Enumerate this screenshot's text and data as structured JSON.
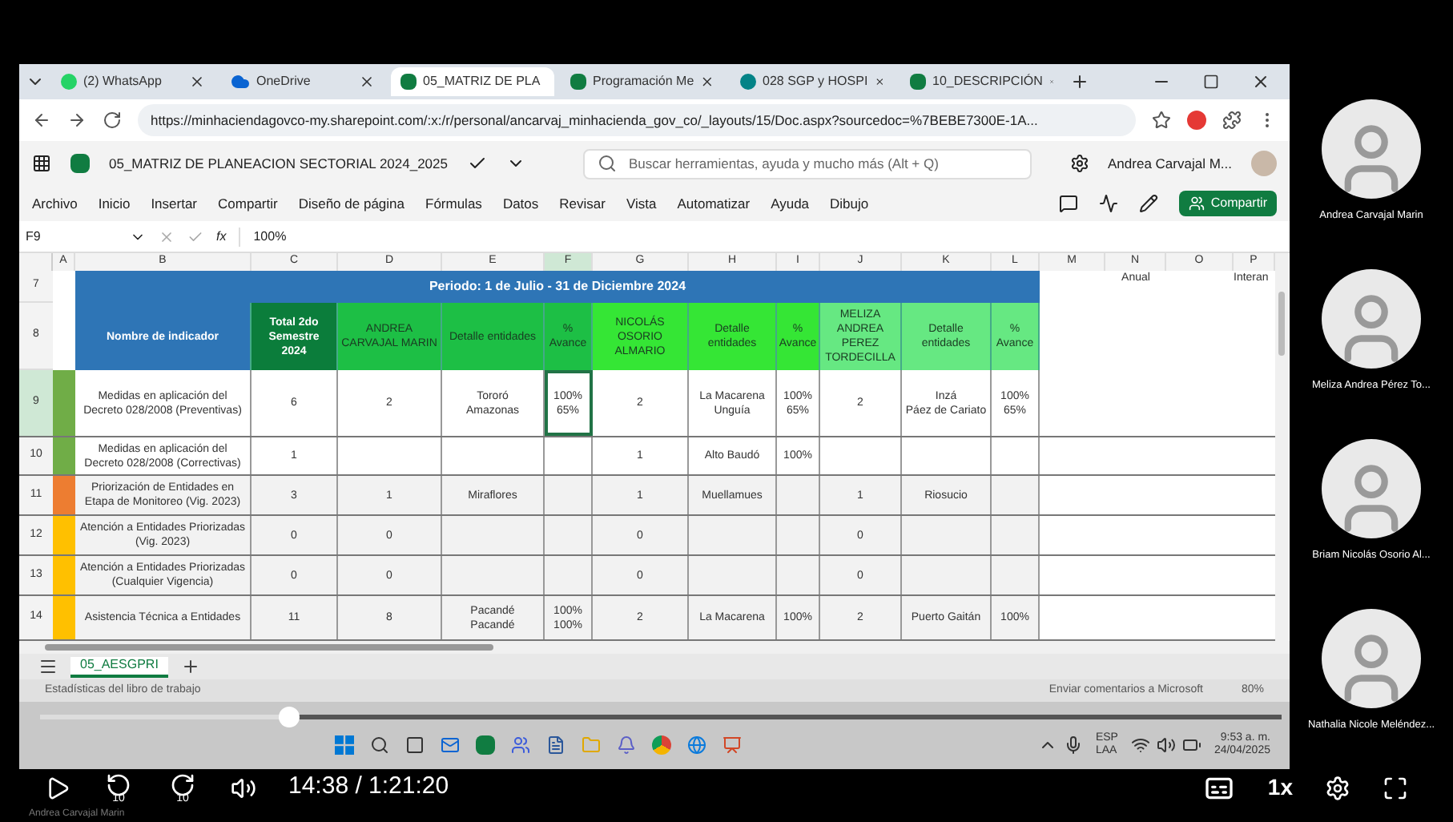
{
  "browser": {
    "tabs": [
      {
        "label": "(2) WhatsApp",
        "kind": "whatsapp",
        "selected": false
      },
      {
        "label": "OneDrive",
        "kind": "onedrive",
        "selected": false
      },
      {
        "label": "05_MATRIZ DE PLA",
        "kind": "excel",
        "selected": true
      },
      {
        "label": "Programación Me",
        "kind": "excel",
        "selected": false
      },
      {
        "label": "028 SGP y HOSPI",
        "kind": "sharepoint",
        "selected": false
      },
      {
        "label": "10_DESCRIPCIÓN",
        "kind": "excel",
        "selected": false
      }
    ],
    "url": "https://minhaciendagovco-my.sharepoint.com/:x:/r/personal/ancarvaj_minhacienda_gov_co/_layouts/15/Doc.aspx?sourcedoc=%7BEBE7300E-1A..."
  },
  "excel": {
    "file_name": "05_MATRIZ DE PLANEACION SECTORIAL 2024_2025",
    "search": {
      "placeholder": "Buscar herramientas, ayuda y mucho más (Alt + Q)"
    },
    "user": "Andrea Carvajal M...",
    "menu": [
      "Archivo",
      "Inicio",
      "Insertar",
      "Compartir",
      "Diseño de página",
      "Fórmulas",
      "Datos",
      "Revisar",
      "Vista",
      "Automatizar",
      "Ayuda",
      "Dibujo"
    ],
    "share_button": "Compartir",
    "cell_ref": "F9",
    "function_symbol": "fx",
    "formula": "100%",
    "columns": [
      "A",
      "B",
      "C",
      "D",
      "E",
      "F",
      "G",
      "H",
      "I",
      "J",
      "K",
      "L",
      "M",
      "N",
      "O",
      "P"
    ],
    "period_row": {
      "number": "7",
      "title": "Periodo: 1 de Julio - 31 de Diciembre 2024",
      "column_n": "Anual",
      "column_p": "Interan"
    },
    "header_row": {
      "number": "8",
      "cells": [
        {},
        {
          "text": "Nombre de indicador",
          "color": "#2e75b6"
        },
        {
          "text": "Total 2do Semestre 2024",
          "color": "#0b7d3b"
        },
        {
          "text": "ANDREA CARVAJAL MARIN",
          "color": "#1dbf45"
        },
        {
          "text": "Detalle entidades",
          "color": "#1dbf45"
        },
        {
          "text": "% Avance",
          "color": "#1dbf45"
        },
        {
          "text": "NICOLÁS OSORIO ALMARIO",
          "color": "#35e635"
        },
        {
          "text": "Detalle entidades",
          "color": "#35e635"
        },
        {
          "text": "% Avance",
          "color": "#35e635"
        },
        {
          "text": "MELIZA ANDREA PEREZ TORDECILLA",
          "color": "#66e882"
        },
        {
          "text": "Detalle entidades",
          "color": "#66e882"
        },
        {
          "text": "% Avance",
          "color": "#66e882"
        }
      ]
    },
    "rows": [
      {
        "number": "9",
        "cells": [
          {
            "color": "#70ad47"
          },
          {
            "lines": [
              "Medidas en aplicación del Decreto 028/2008 (Preventivas)"
            ],
            "selected": false
          },
          {
            "lines": [
              "6"
            ],
            "selected": false
          },
          {
            "lines": [
              "2"
            ],
            "selected": false
          },
          {
            "lines": [
              "Tororó",
              "Amazonas"
            ],
            "selected": false
          },
          {
            "lines": [
              "100%",
              "65%"
            ],
            "selected": true
          },
          {
            "lines": [
              "2"
            ],
            "selected": false
          },
          {
            "lines": [
              "La Macarena",
              "Unguía"
            ],
            "selected": false
          },
          {
            "lines": [
              "100%",
              "65%"
            ],
            "selected": false
          },
          {
            "lines": [
              "2"
            ],
            "selected": false
          },
          {
            "lines": [
              "Inzá",
              "Páez de Cariato"
            ],
            "selected": false
          },
          {
            "lines": [
              "100%",
              "65%"
            ],
            "selected": false
          }
        ]
      },
      {
        "number": "10",
        "cells": [
          {
            "color": "#70ad47"
          },
          {
            "lines": [
              "Medidas en aplicación del Decreto 028/2008 (Correctivas)"
            ],
            "selected": false
          },
          {
            "lines": [
              "1"
            ],
            "selected": false
          },
          {
            "selected": false
          },
          {
            "selected": false
          },
          {
            "selected": false
          },
          {
            "lines": [
              "1"
            ],
            "selected": false
          },
          {
            "lines": [
              "Alto Baudó"
            ],
            "selected": false
          },
          {
            "lines": [
              "100%"
            ],
            "selected": false
          },
          {
            "selected": false
          },
          {
            "selected": false
          },
          {
            "selected": false
          }
        ]
      },
      {
        "number": "11",
        "cells": [
          {
            "color": "#ed7d31"
          },
          {
            "lines": [
              "Priorización de Entidades en Etapa de Monitoreo (Vig. 2023)"
            ],
            "selected": false
          },
          {
            "lines": [
              "3"
            ],
            "selected": false
          },
          {
            "lines": [
              "1"
            ],
            "selected": false
          },
          {
            "lines": [
              "Miraflores"
            ],
            "selected": false
          },
          {
            "selected": false
          },
          {
            "lines": [
              "1"
            ],
            "selected": false
          },
          {
            "lines": [
              "Muellamues"
            ],
            "selected": false
          },
          {
            "selected": false
          },
          {
            "lines": [
              "1"
            ],
            "selected": false
          },
          {
            "lines": [
              "Riosucio"
            ],
            "selected": false
          },
          {
            "selected": false
          }
        ]
      },
      {
        "number": "12",
        "cells": [
          {
            "color": "#ffc000"
          },
          {
            "lines": [
              "Atención a Entidades Priorizadas (Vig. 2023)"
            ],
            "selected": false
          },
          {
            "lines": [
              "0"
            ],
            "selected": false
          },
          {
            "lines": [
              "0"
            ],
            "selected": false
          },
          {
            "selected": false
          },
          {
            "selected": false
          },
          {
            "lines": [
              "0"
            ],
            "selected": false
          },
          {
            "selected": false
          },
          {
            "selected": false
          },
          {
            "lines": [
              "0"
            ],
            "selected": false
          },
          {
            "selected": false
          },
          {
            "selected": false
          }
        ]
      },
      {
        "number": "13",
        "cells": [
          {
            "color": "#ffc000"
          },
          {
            "lines": [
              "Atención a Entidades Priorizadas (Cualquier Vigencia)"
            ],
            "selected": false
          },
          {
            "lines": [
              "0"
            ],
            "selected": false
          },
          {
            "lines": [
              "0"
            ],
            "selected": false
          },
          {
            "selected": false
          },
          {
            "selected": false
          },
          {
            "lines": [
              "0"
            ],
            "selected": false
          },
          {
            "selected": false
          },
          {
            "selected": false
          },
          {
            "lines": [
              "0"
            ],
            "selected": false
          },
          {
            "selected": false
          },
          {
            "selected": false
          }
        ]
      },
      {
        "number": "14",
        "cells": [
          {
            "color": "#ffc000"
          },
          {
            "lines": [
              "Asistencia Técnica a Entidades"
            ],
            "selected": false
          },
          {
            "lines": [
              "11"
            ],
            "selected": false
          },
          {
            "lines": [
              "8"
            ],
            "selected": false
          },
          {
            "lines": [
              "Pacandé",
              "Pacandé"
            ],
            "selected": false
          },
          {
            "lines": [
              "100%",
              "100%"
            ],
            "selected": false
          },
          {
            "lines": [
              "2"
            ],
            "selected": false
          },
          {
            "lines": [
              "La Macarena"
            ],
            "selected": false
          },
          {
            "lines": [
              "100%"
            ],
            "selected": false
          },
          {
            "lines": [
              "2"
            ],
            "selected": false
          },
          {
            "lines": [
              "Puerto Gaitán"
            ],
            "selected": false
          },
          {
            "lines": [
              "100%"
            ],
            "selected": false
          }
        ]
      }
    ],
    "sheet_tab": {
      "label": "05_AESGPRI",
      "selected": true
    },
    "status_left": "Estadísticas del libro de trabajo",
    "status_right": "Enviar comentarios a Microsoft",
    "zoom": "80%"
  },
  "taskbar": {
    "language": "ESP",
    "layout": "LAA",
    "time": "9:53 a. m.",
    "date": "24/04/2025"
  },
  "participants": [
    {
      "name": "Andrea Carvajal Marin"
    },
    {
      "name": "Meliza Andrea Pérez To..."
    },
    {
      "name": "Briam Nicolás Osorio Al..."
    },
    {
      "name": "Nathalia Nicole Meléndez..."
    }
  ],
  "player": {
    "level": 0.2,
    "skip_back": "10",
    "skip_forward": "10",
    "time": "14:38 / 1:21:20",
    "speed": "1x"
  },
  "caption": "Andrea Carvajal Marin"
}
